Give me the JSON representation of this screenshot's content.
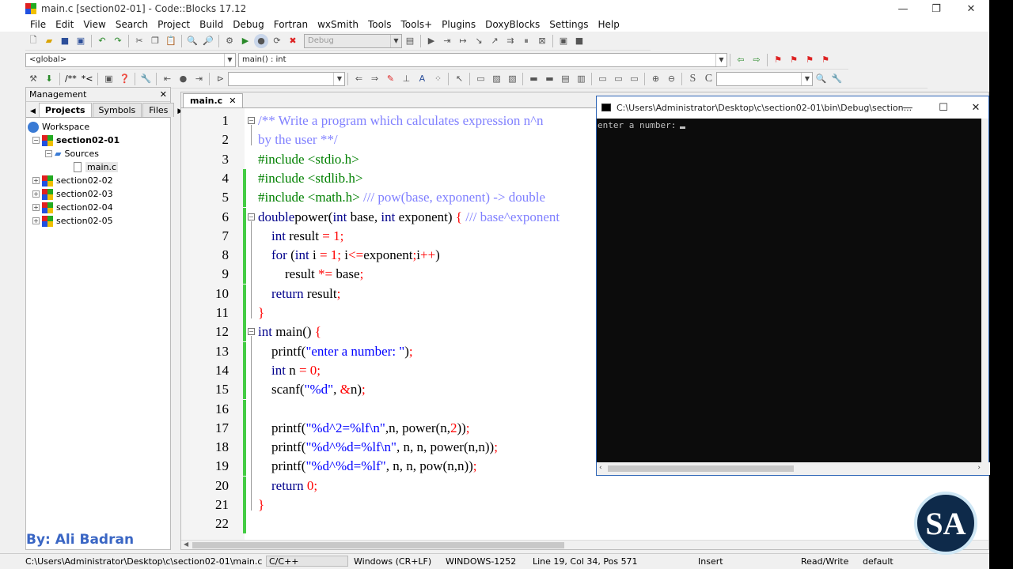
{
  "window": {
    "title": "main.c [section02-01] - Code::Blocks 17.12",
    "minimize": "—",
    "maximize": "❐",
    "close": "✕"
  },
  "menu": [
    "File",
    "Edit",
    "View",
    "Search",
    "Project",
    "Build",
    "Debug",
    "Fortran",
    "wxSmith",
    "Tools",
    "Tools+",
    "Plugins",
    "DoxyBlocks",
    "Settings",
    "Help"
  ],
  "toolbar": {
    "build_target": "Debug",
    "scope": "<global>",
    "function": "main() : int",
    "doxy_labels": [
      "/**",
      "*<"
    ]
  },
  "management": {
    "title": "Management",
    "close": "✕",
    "tabs": [
      "Projects",
      "Symbols",
      "Files"
    ],
    "workspace": "Workspace",
    "active_project": "section02-01",
    "sources_folder": "Sources",
    "file": "main.c",
    "projects": [
      "section02-02",
      "section02-03",
      "section02-04",
      "section02-05"
    ]
  },
  "byline": "By: Ali Badran",
  "editor": {
    "tab_label": "main.c",
    "tab_close": "✕"
  },
  "console": {
    "title": "C:\\Users\\Administrator\\Desktop\\c\\section02-01\\bin\\Debug\\section...",
    "output": "enter a number:",
    "minimize": "—",
    "maximize": "☐",
    "close": "✕"
  },
  "status": {
    "path": "C:\\Users\\Administrator\\Desktop\\c\\section02-01\\main.c",
    "language": "C/C++",
    "eol": "Windows (CR+LF)",
    "encoding": "WINDOWS-1252",
    "position": "Line 19, Col 34, Pos 571",
    "mode": "Insert",
    "access": "Read/Write",
    "profile": "default"
  },
  "logo_text": "SA",
  "colors": {
    "keyword": "#00008b",
    "comment": "#8080ff",
    "preprocessor": "#008000",
    "string": "#0000ff",
    "number": "#ff0000",
    "change_bar": "#44cc44",
    "byline": "#3a66c4"
  },
  "code_lines": [
    {
      "n": "1",
      "t": [
        [
          "cm",
          "/** Write a program which calculates expression n^n"
        ]
      ]
    },
    {
      "n": "2",
      "t": [
        [
          "cm",
          "by the user **/"
        ]
      ]
    },
    {
      "n": "3",
      "t": [
        [
          "pp",
          "#include <stdio.h>"
        ]
      ]
    },
    {
      "n": "4",
      "t": [
        [
          "pp",
          "#include <stdlib.h>"
        ]
      ]
    },
    {
      "n": "5",
      "t": [
        [
          "pp",
          "#include <math.h> "
        ],
        [
          "cm",
          "/// pow(base, exponent) -> double"
        ]
      ]
    },
    {
      "n": "6",
      "t": [
        [
          "kw",
          "double"
        ],
        [
          "",
          "power("
        ],
        [
          "kw",
          "int"
        ],
        [
          "",
          " base, "
        ],
        [
          "kw",
          "int"
        ],
        [
          "",
          " exponent) "
        ],
        [
          "op",
          "{ "
        ],
        [
          "cm",
          "/// base^exponent"
        ]
      ]
    },
    {
      "n": "7",
      "t": [
        [
          "",
          "    "
        ],
        [
          "kw",
          "int"
        ],
        [
          "",
          " result "
        ],
        [
          "op",
          "="
        ],
        [
          "",
          " "
        ],
        [
          "nm",
          "1"
        ],
        [
          "op",
          ";"
        ]
      ]
    },
    {
      "n": "8",
      "t": [
        [
          "",
          "    "
        ],
        [
          "kw",
          "for"
        ],
        [
          "",
          " ("
        ],
        [
          "kw",
          "int"
        ],
        [
          "",
          " i "
        ],
        [
          "op",
          "="
        ],
        [
          "",
          " "
        ],
        [
          "nm",
          "1"
        ],
        [
          "op",
          ";"
        ],
        [
          "",
          " i"
        ],
        [
          "op",
          "<="
        ],
        [
          "",
          "exponent"
        ],
        [
          "op",
          ";"
        ],
        [
          "",
          "i"
        ],
        [
          "op",
          "++"
        ],
        [
          "",
          ")"
        ]
      ]
    },
    {
      "n": "9",
      "t": [
        [
          "",
          "        result "
        ],
        [
          "op",
          "*="
        ],
        [
          "",
          " base"
        ],
        [
          "op",
          ";"
        ]
      ]
    },
    {
      "n": "10",
      "t": [
        [
          "",
          "    "
        ],
        [
          "kw",
          "return"
        ],
        [
          "",
          " result"
        ],
        [
          "op",
          ";"
        ]
      ]
    },
    {
      "n": "11",
      "t": [
        [
          "op",
          "}"
        ]
      ]
    },
    {
      "n": "12",
      "t": [
        [
          "kw",
          "int"
        ],
        [
          "",
          " main() "
        ],
        [
          "op",
          "{"
        ]
      ]
    },
    {
      "n": "13",
      "t": [
        [
          "",
          "    printf("
        ],
        [
          "st",
          "\"enter a number: \""
        ],
        [
          "",
          ")"
        ],
        [
          "op",
          ";"
        ]
      ]
    },
    {
      "n": "14",
      "t": [
        [
          "",
          "    "
        ],
        [
          "kw",
          "int"
        ],
        [
          "",
          " n "
        ],
        [
          "op",
          "="
        ],
        [
          "",
          " "
        ],
        [
          "nm",
          "0"
        ],
        [
          "op",
          ";"
        ]
      ]
    },
    {
      "n": "15",
      "t": [
        [
          "",
          "    scanf("
        ],
        [
          "st",
          "\"%d\""
        ],
        [
          "",
          ", "
        ],
        [
          "op",
          "&"
        ],
        [
          "",
          "n)"
        ],
        [
          "op",
          ";"
        ]
      ]
    },
    {
      "n": "16",
      "t": []
    },
    {
      "n": "17",
      "t": [
        [
          "",
          "    printf("
        ],
        [
          "st",
          "\"%d^2=%lf\\n\""
        ],
        [
          "",
          ",n, power(n,"
        ],
        [
          "nm",
          "2"
        ],
        [
          "",
          "))"
        ],
        [
          "op",
          ";"
        ]
      ]
    },
    {
      "n": "18",
      "t": [
        [
          "",
          "    printf("
        ],
        [
          "st",
          "\"%d^%d=%lf\\n\""
        ],
        [
          "",
          ", n, n, power(n,n))"
        ],
        [
          "op",
          ";"
        ]
      ]
    },
    {
      "n": "19",
      "t": [
        [
          "",
          "    printf("
        ],
        [
          "st",
          "\"%d^%d=%lf\""
        ],
        [
          "",
          ", n, n, pow(n,n))"
        ],
        [
          "op",
          ";"
        ]
      ]
    },
    {
      "n": "20",
      "t": [
        [
          "",
          "    "
        ],
        [
          "kw",
          "return"
        ],
        [
          "",
          " "
        ],
        [
          "nm",
          "0"
        ],
        [
          "op",
          ";"
        ]
      ]
    },
    {
      "n": "21",
      "t": [
        [
          "op",
          "}"
        ]
      ]
    },
    {
      "n": "22",
      "t": []
    }
  ]
}
